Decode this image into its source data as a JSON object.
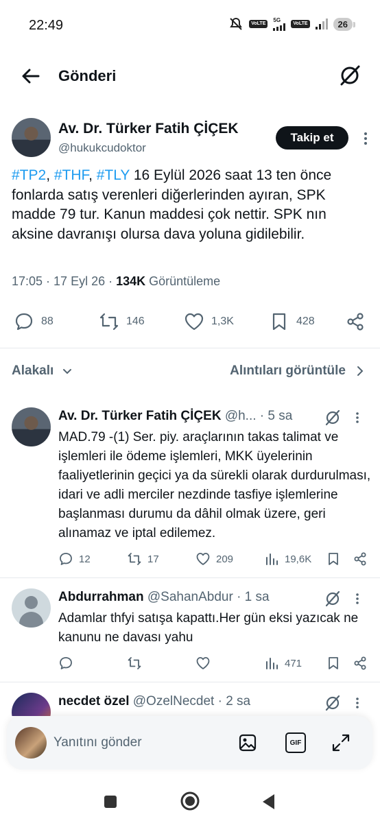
{
  "status_bar": {
    "time": "22:49",
    "network1": "VoLTE",
    "network2": "5G",
    "network3": "VoLTE",
    "battery": "26"
  },
  "header": {
    "title": "Gönderi"
  },
  "main_tweet": {
    "author_name": "Av. Dr. Türker Fatih ÇİÇEK",
    "author_handle": "@hukukcudoktor",
    "follow_label": "Takip et",
    "hashtags": [
      "#TP2",
      "#THF",
      "#TLY"
    ],
    "text": " 16 Eylül 2026 saat 13 ten önce fonlarda satış verenleri diğerlerinden ayıran, SPK madde 79 tur. Kanun maddesi çok nettir. SPK nın aksine davranışı olursa dava yoluna gidilebilir.",
    "time": "17:05 · 17 Eyl 26 · ",
    "views": "134K",
    "views_label": " Görüntüleme",
    "replies": "88",
    "reposts": "146",
    "likes": "1,3K",
    "bookmarks": "428"
  },
  "sort": {
    "left_label": "Alakalı",
    "right_label": "Alıntıları görüntüle"
  },
  "replies": [
    {
      "name": "Av. Dr. Türker Fatih ÇİÇEK",
      "handle": "@h...",
      "age": " · 5 sa",
      "text": "MAD.79 -(1) Ser. piy. araçlarının takas talimat ve işlemleri ile ödeme işlemleri, MKK üyelerinin faaliyetlerinin geçici ya da sürekli olarak durdurulması, idari ve adli merciler nezdinde tasfiye işlemlerine başlanması durumu da dâhil olmak üzere, geri alınamaz ve iptal edilemez.",
      "replies": "12",
      "reposts": "17",
      "likes": "209",
      "views": "19,6K"
    },
    {
      "name": "Abdurrahman",
      "handle": "@SahanAbdur",
      "age": " · 1 sa",
      "text": "Adamlar thfyi satışa kapattı.Her gün eksi yazıcak ne kanunu ne davası yahu",
      "replies": "",
      "reposts": "",
      "likes": "",
      "views": "471"
    },
    {
      "name": "necdet özel",
      "handle": "@OzelNecdet",
      "age": " · 2 sa"
    }
  ],
  "reply_bar": {
    "placeholder": "Yanıtını gönder",
    "gif_label": "GIF"
  },
  "icons": {
    "back": "arrow-left-icon",
    "grok": "grok-icon",
    "reply": "speech-bubble-icon",
    "repost": "repost-icon",
    "like": "heart-icon",
    "bookmark": "bookmark-icon",
    "share": "share-icon",
    "views": "bar-chart-icon",
    "image": "image-icon",
    "gif": "gif-icon",
    "expand": "expand-icon"
  },
  "colors": {
    "accent": "#1d9bf0",
    "text": "#0f1419",
    "muted": "#536471",
    "follow_bg": "#0f1419"
  }
}
